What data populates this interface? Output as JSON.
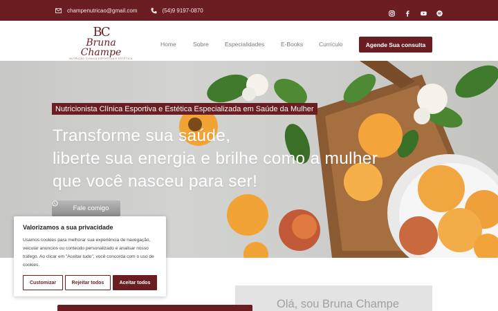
{
  "topbar": {
    "email": "champenutricao@gmail.com",
    "phone": "(54)9 9197-0870",
    "icons": [
      "mail-icon",
      "phone-icon",
      "instagram-icon",
      "facebook-icon",
      "youtube-icon",
      "spotify-icon"
    ]
  },
  "logo": {
    "monogram": "BC",
    "name": "Bruna Champe",
    "tagline": "NUTRIÇÃO CLÍNICA ESPORTIVA E ESTÉTICA FEMININA"
  },
  "nav": {
    "items": [
      "Home",
      "Sobre",
      "Especialidades",
      "E-Books",
      "Currículo"
    ],
    "cta": "Agende Sua consulta"
  },
  "hero": {
    "badge": "Nutricionista Clínica Esportiva  e Estética Especializada em Saúde da Mulher",
    "title_lines": [
      "Transforme sua saúde,",
      "liberte sua energia e brilhe como a mulher",
      "que você nasceu para ser!"
    ],
    "button": "Fale comigo"
  },
  "about": {
    "title": "Olá, sou Bruna Champe"
  },
  "cookie": {
    "title": "Valorizamos a sua privacidade",
    "text": "Usamos cookies para melhorar sua experiência de navegação, veicular anúncios ou conteúdo personalizado e analisar nosso tráfego. Ao clicar em \"Aceitar tudo\", você concorda com o uso de cookies.",
    "customize": "Customizar",
    "reject": "Rejeitar todos",
    "accept": "Aceitar todos"
  },
  "colors": {
    "brand": "#6b1e22",
    "hero_bg": "#cfd0ce",
    "about_card": "#e3e3e3"
  }
}
